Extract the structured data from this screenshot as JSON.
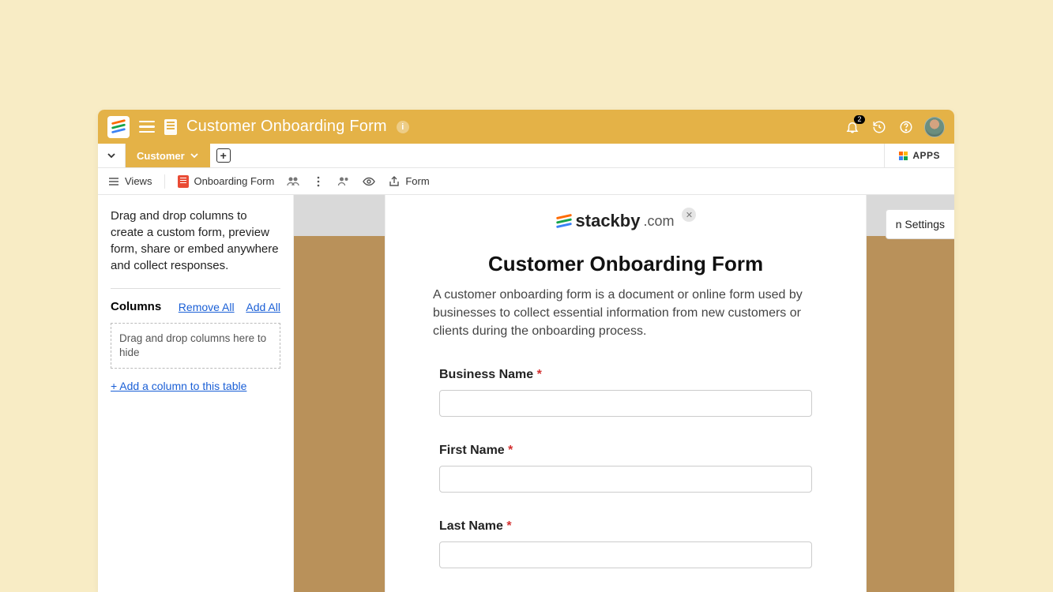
{
  "header": {
    "title": "Customer Onboarding Form",
    "notifications_count": "2"
  },
  "tabs": {
    "active": "Customer",
    "apps_label": "APPS"
  },
  "viewbar": {
    "views_label": "Views",
    "form_name": "Onboarding Form",
    "form_label": "Form"
  },
  "sidebar": {
    "description": "Drag and drop columns to create a custom form, preview form, share or embed anywhere and collect responses.",
    "columns_heading": "Columns",
    "remove_all": "Remove All",
    "add_all": "Add All",
    "dropzone": "Drag and drop columns here to hide",
    "add_column": "+ Add a column to this table"
  },
  "settings_tab": "Settings",
  "brand": {
    "name": "stackby",
    "domain": ".com"
  },
  "form": {
    "title": "Customer Onboarding Form",
    "description": "A customer onboarding form is a document or online form used by businesses to collect essential information from new customers or clients during the onboarding process.",
    "fields": [
      {
        "label": "Business Name",
        "required": true
      },
      {
        "label": "First Name",
        "required": true
      },
      {
        "label": "Last Name",
        "required": true
      }
    ]
  }
}
